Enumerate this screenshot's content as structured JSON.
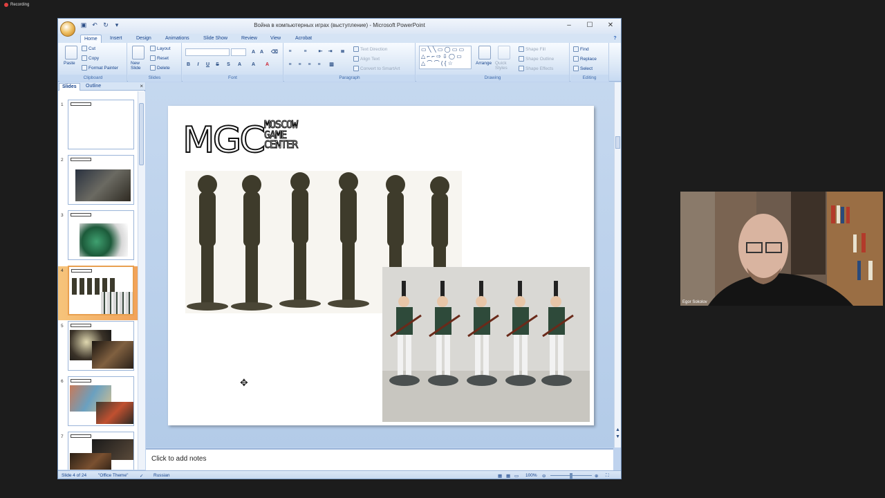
{
  "recording": {
    "label": "Recording"
  },
  "window": {
    "title": "Война в компьютерных играх (выступление) - Microsoft PowerPoint",
    "controls": [
      "–",
      "☐",
      "✕"
    ]
  },
  "ribbon_tabs": [
    "Home",
    "Insert",
    "Design",
    "Animations",
    "Slide Show",
    "Review",
    "View",
    "Acrobat"
  ],
  "clipboard": {
    "paste": "Paste",
    "cut": "Cut",
    "copy": "Copy",
    "format_painter": "Format Painter",
    "label": "Clipboard"
  },
  "slides_group": {
    "new_slide": "New Slide",
    "layout": "Layout",
    "reset": "Reset",
    "delete": "Delete",
    "label": "Slides"
  },
  "font_group": {
    "label": "Font"
  },
  "paragraph_group": {
    "text_direction": "Text Direction",
    "align_text": "Align Text",
    "convert_smartart": "Convert to SmartArt",
    "label": "Paragraph"
  },
  "drawing_group": {
    "arrange": "Arrange",
    "quick_styles": "Quick Styles",
    "shape_fill": "Shape Fill",
    "shape_outline": "Shape Outline",
    "shape_effects": "Shape Effects",
    "label": "Drawing"
  },
  "editing_group": {
    "find": "Find",
    "replace": "Replace",
    "select": "Select",
    "label": "Editing"
  },
  "left_pane": {
    "tab_slides": "Slides",
    "tab_outline": "Outline",
    "close": "×",
    "thumbs": [
      {
        "num": "1"
      },
      {
        "num": "2"
      },
      {
        "num": "3"
      },
      {
        "num": "4"
      },
      {
        "num": "5"
      },
      {
        "num": "6"
      },
      {
        "num": "7"
      }
    ],
    "selected_index": 4
  },
  "slide": {
    "logo_letters": "MGC",
    "logo_text": [
      "MOSCOW",
      "GAME",
      "CENTER"
    ]
  },
  "notes": {
    "placeholder": "Click to add notes"
  },
  "status": {
    "slide_of": "Slide 4 of 24",
    "theme": "\"Office Theme\"",
    "language": "Russian",
    "zoom": "100%"
  },
  "webcam": {
    "name": "Egor Sokolov"
  }
}
